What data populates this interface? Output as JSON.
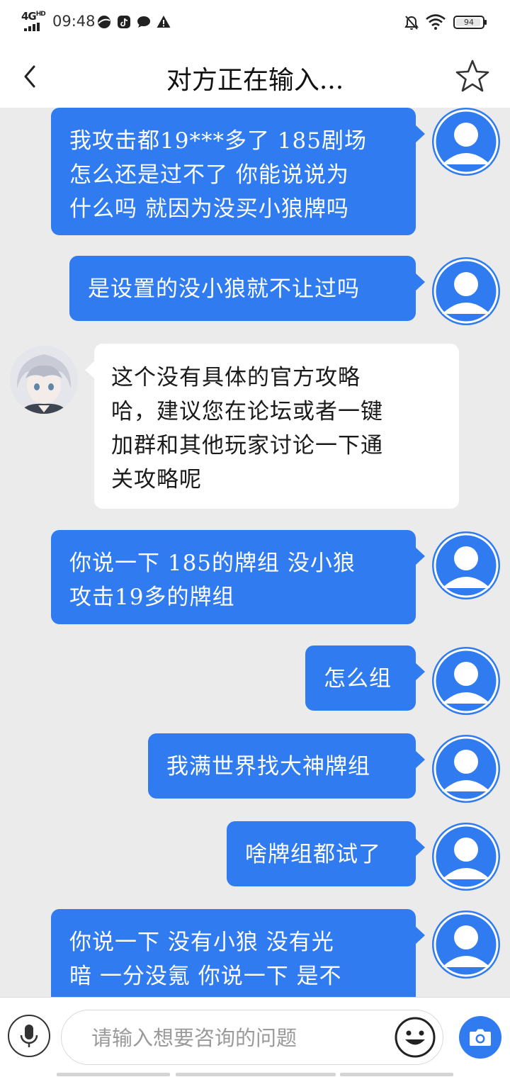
{
  "status_bar": {
    "network": "4G",
    "network_hd": "HD",
    "time": "09:48",
    "battery": "94",
    "icons": [
      "browser-icon",
      "tiktok-icon",
      "chat-icon",
      "warning-icon",
      "mute-bell-icon",
      "wifi-icon"
    ]
  },
  "header": {
    "title": "对方正在输入...",
    "back_icon": "chevron-left-icon",
    "favorite_icon": "star-outline-icon"
  },
  "messages": [
    {
      "sender": "user",
      "lines": [
        "我攻击都19***多了 185剧场",
        "怎么还是过不了 你能说说为",
        "什么吗 就因为没买小狼牌吗"
      ]
    },
    {
      "sender": "user",
      "lines": [
        "是设置的没小狼就不让过吗"
      ]
    },
    {
      "sender": "agent",
      "lines": [
        "这个没有具体的官方攻略",
        "哈，建议您在论坛或者一键",
        "加群和其他玩家讨论一下通",
        "关攻略呢"
      ]
    },
    {
      "sender": "user",
      "lines": [
        "你说一下 185的牌组 没小狼",
        "攻击19多的牌组"
      ]
    },
    {
      "sender": "user",
      "lines": [
        "怎么组"
      ]
    },
    {
      "sender": "user",
      "lines": [
        "我满世界找大神牌组"
      ]
    },
    {
      "sender": "user",
      "lines": [
        "啥牌组都试了"
      ]
    },
    {
      "sender": "user",
      "lines": [
        "你说一下 没有小狼 没有光",
        "暗 一分没氪 你说一下 是不"
      ]
    }
  ],
  "input_bar": {
    "placeholder": "请输入想要咨询的问题",
    "value": "",
    "mic_icon": "microphone-icon",
    "emoji_icon": "emoji-icon",
    "camera_icon": "camera-icon"
  },
  "colors": {
    "accent": "#2f7bef",
    "chat_background": "#ebebeb",
    "incoming_bubble": "#ffffff"
  }
}
